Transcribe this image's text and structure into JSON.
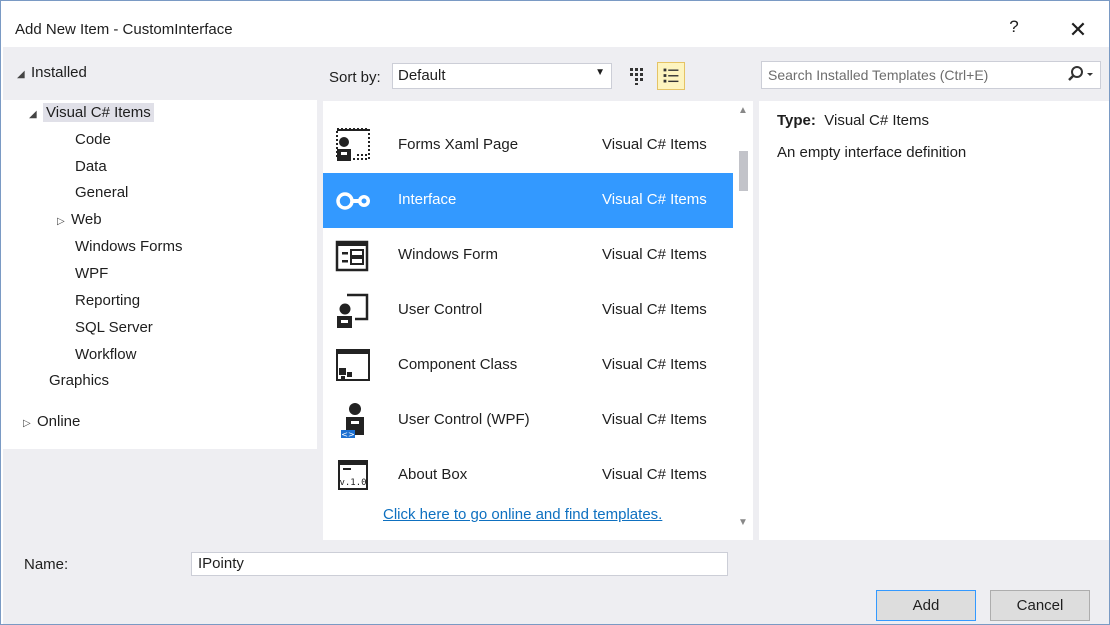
{
  "window": {
    "title": "Add New Item - CustomInterface",
    "help": "?",
    "close": "✕"
  },
  "left": {
    "installed": "Installed",
    "tree": [
      {
        "label": "Visual C# Items",
        "level": 0,
        "expanded": true,
        "selected": true
      },
      {
        "label": "Code",
        "level": 1
      },
      {
        "label": "Data",
        "level": 1
      },
      {
        "label": "General",
        "level": 1
      },
      {
        "label": "Web",
        "level": 1,
        "collapsed": true
      },
      {
        "label": "Windows Forms",
        "level": 1
      },
      {
        "label": "WPF",
        "level": 1
      },
      {
        "label": "Reporting",
        "level": 1
      },
      {
        "label": "SQL Server",
        "level": 1
      },
      {
        "label": "Workflow",
        "level": 1
      },
      {
        "label": "Graphics",
        "level": 0
      }
    ],
    "online": "Online"
  },
  "sort": {
    "label": "Sort by:",
    "value": "Default"
  },
  "templates": [
    {
      "name": "Forms Xaml Page",
      "category": "Visual C# Items",
      "icon": "forms-xaml-icon",
      "selected": false
    },
    {
      "name": "Interface",
      "category": "Visual C# Items",
      "icon": "interface-icon",
      "selected": true
    },
    {
      "name": "Windows Form",
      "category": "Visual C# Items",
      "icon": "windows-form-icon",
      "selected": false
    },
    {
      "name": "User Control",
      "category": "Visual C# Items",
      "icon": "user-control-icon",
      "selected": false
    },
    {
      "name": "Component Class",
      "category": "Visual C# Items",
      "icon": "component-class-icon",
      "selected": false
    },
    {
      "name": "User Control (WPF)",
      "category": "Visual C# Items",
      "icon": "user-control-wpf-icon",
      "selected": false
    },
    {
      "name": "About Box",
      "category": "Visual C# Items",
      "icon": "about-box-icon",
      "selected": false
    }
  ],
  "online_link": "Click here to go online and find templates.",
  "search": {
    "placeholder": "Search Installed Templates (Ctrl+E)"
  },
  "details": {
    "type_label": "Type:",
    "type_value": "Visual C# Items",
    "description": "An empty interface definition"
  },
  "name_field": {
    "label": "Name:",
    "value": "IPointy"
  },
  "buttons": {
    "add": "Add",
    "cancel": "Cancel"
  },
  "colors": {
    "selection": "#3399ff",
    "panel": "#eeeef2",
    "link": "#0e70c0"
  }
}
